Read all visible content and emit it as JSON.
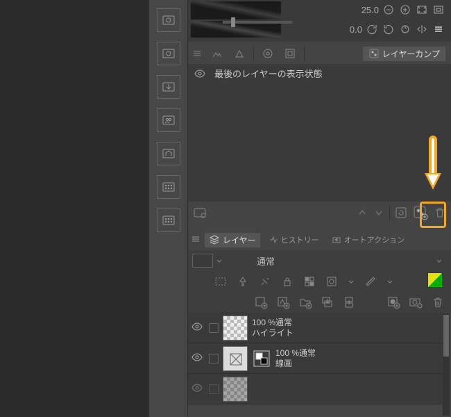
{
  "nav": {
    "zoom": "25.0",
    "rotation": "0.0"
  },
  "layerComps": {
    "tabLabel": "レイヤーカンプ",
    "row1": "最後のレイヤーの表示状態"
  },
  "layersPanel": {
    "tabLayer": "レイヤー",
    "tabHistory": "ヒストリー",
    "tabAutoAction": "オートアクション",
    "blendMode": "通常"
  },
  "layers": [
    {
      "opacity": "100 %通常",
      "name": "ハイライト"
    },
    {
      "opacity": "100 %通常",
      "name": "線画"
    }
  ]
}
